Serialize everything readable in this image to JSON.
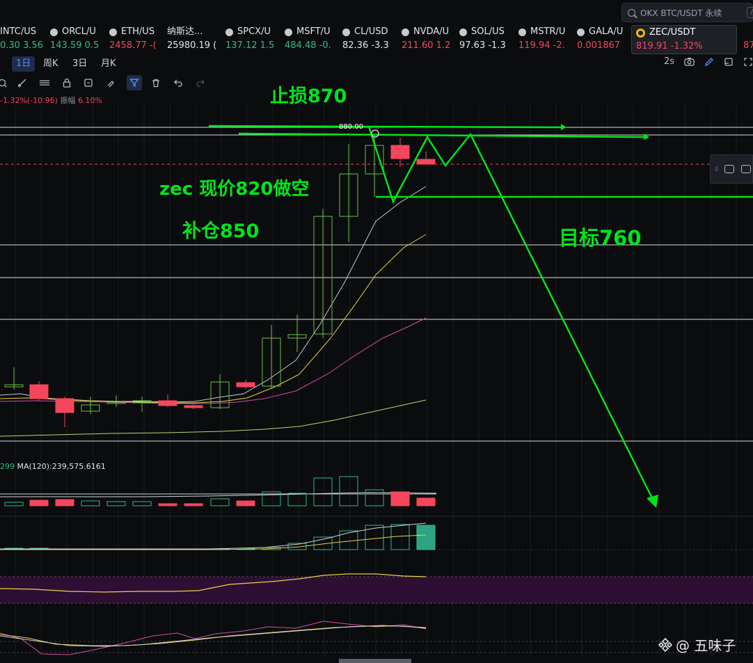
{
  "search": {
    "placeholder": "OKX BTC/USDT 永续",
    "slash": "/"
  },
  "tickers": [
    {
      "name": "INTC/US",
      "price": "0.30",
      "change": "3.56",
      "dir": "up"
    },
    {
      "name": "ORCL/U",
      "price": "143.59",
      "change": "0.5",
      "dir": "up"
    },
    {
      "name": "ETH/US",
      "price": "2458.77",
      "change": "-(",
      "dir": "dn"
    },
    {
      "name": "纳斯达...",
      "price": "25980.19",
      "change": "(",
      "dir": "neutral"
    },
    {
      "name": "SPCX/U",
      "price": "137.12",
      "change": "1.5",
      "dir": "up"
    },
    {
      "name": "MSFT/U",
      "price": "484.48",
      "change": "-0.",
      "dir": "up"
    },
    {
      "name": "CL/USD",
      "price": "82.36",
      "change": "-3.3",
      "dir": "neutral"
    },
    {
      "name": "NVDA/U",
      "price": "211.60",
      "change": "1.2",
      "dir": "dn"
    },
    {
      "name": "SOL/US",
      "price": "97.63",
      "change": "-1.3",
      "dir": "neutral"
    },
    {
      "name": "MSTR/U",
      "price": "119.94",
      "change": "-2.",
      "dir": "dn"
    },
    {
      "name": "GALA/U",
      "price": "0.001867",
      "change": "",
      "dir": "dn"
    },
    {
      "name": "ZEC/USDT",
      "price": "819.91",
      "change": "-1.32%",
      "dir": "dn",
      "active": true
    },
    {
      "name": "",
      "price": "87",
      "change": "",
      "dir": "dn"
    }
  ],
  "timeframes": [
    "1日",
    "周K",
    "3日",
    "月K"
  ],
  "selected_timeframe": "1日",
  "refresh": "2s",
  "info": {
    "change": "-1.32%(-10.96)",
    "amp_label": "振幅",
    "amp": "6.10%"
  },
  "price_marker": "880.00",
  "ma_panel": {
    "prefix": "299",
    "label": "MA(120):239,575.6161"
  },
  "annotations": {
    "stop_loss": "止损870",
    "short_entry": "zec 现价820做空",
    "add_position": "补仓850",
    "target": "目标760"
  },
  "watermark": "@ 五味子",
  "colors": {
    "up": "#2ebd85",
    "down": "#f6465d",
    "annotation": "#00e51a",
    "accent": "#4d8dff",
    "macd_band": "#2e0f33"
  },
  "icons": [
    "search-icon",
    "camera-icon",
    "pencil-icon",
    "layout-icon",
    "fullscreen-icon",
    "crosshair-icon",
    "trend-line-icon",
    "fib-icon",
    "lock-icon",
    "text-note-icon",
    "magnet-icon",
    "filter-icon",
    "trash-icon",
    "undo-icon",
    "redo-icon",
    "binance-logo-icon"
  ]
}
